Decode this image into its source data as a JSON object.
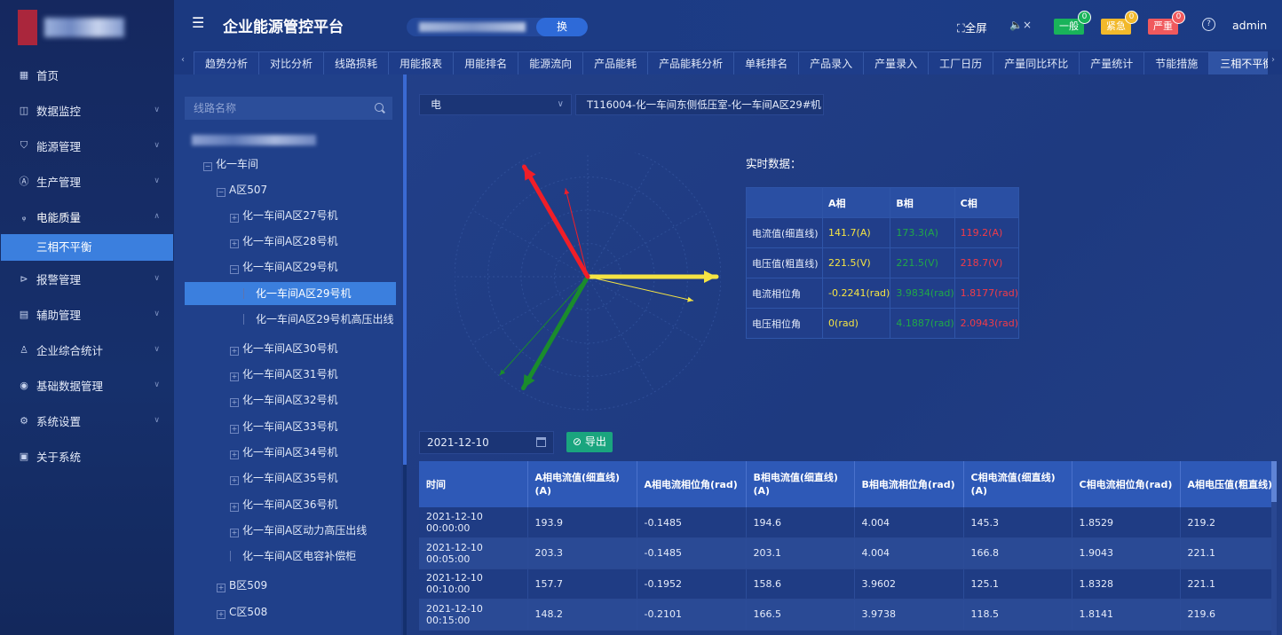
{
  "header": {
    "title": "企业能源管控平台",
    "switch_label": "换",
    "fullscreen_label": "全屏",
    "alarms": [
      {
        "label": "一般",
        "count": "0",
        "color": "#19b35a"
      },
      {
        "label": "紧急",
        "count": "0",
        "color": "#f2b92c"
      },
      {
        "label": "严重",
        "count": "0",
        "color": "#f0595d"
      }
    ],
    "user": "admin"
  },
  "sidebar": {
    "items": [
      {
        "label": "首页",
        "icon": "home-icon"
      },
      {
        "label": "数据监控",
        "icon": "monitor-icon"
      },
      {
        "label": "能源管理",
        "icon": "shield-icon"
      },
      {
        "label": "生产管理",
        "icon": "production-icon"
      },
      {
        "label": "电能质量",
        "icon": "power-quality-icon"
      },
      {
        "label": "报警管理",
        "icon": "alarm-icon"
      },
      {
        "label": "辅助管理",
        "icon": "assist-icon"
      },
      {
        "label": "企业综合统计",
        "icon": "statistics-icon"
      },
      {
        "label": "基础数据管理",
        "icon": "database-icon"
      },
      {
        "label": "系统设置",
        "icon": "settings-icon"
      },
      {
        "label": "关于系统",
        "icon": "about-icon"
      }
    ],
    "submenu_active": "三相不平衡"
  },
  "tabs": [
    "趋势分析",
    "对比分析",
    "线路损耗",
    "用能报表",
    "用能排名",
    "能源流向",
    "产品能耗",
    "产品能耗分析",
    "单耗排名",
    "产品录入",
    "产量录入",
    "工厂日历",
    "产量同比环比",
    "产量统计",
    "节能措施",
    "三相不平衡"
  ],
  "tree": {
    "search_placeholder": "线路名称",
    "nodes": [
      {
        "label": "化一车间",
        "level": 1,
        "toggle": "−"
      },
      {
        "label": "A区507",
        "level": 2,
        "toggle": "−"
      },
      {
        "label": "化一车间A区27号机",
        "level": 3,
        "toggle": "+"
      },
      {
        "label": "化一车间A区28号机",
        "level": 3,
        "toggle": "+"
      },
      {
        "label": "化一车间A区29号机",
        "level": 3,
        "toggle": "−"
      },
      {
        "label": "化一车间A区29号机",
        "level": 4,
        "toggle": "",
        "selected": true
      },
      {
        "label": "化一车间A区29号机高压出线",
        "level": 4,
        "toggle": ""
      },
      {
        "label": "化一车间A区30号机",
        "level": 3,
        "toggle": "+"
      },
      {
        "label": "化一车间A区31号机",
        "level": 3,
        "toggle": "+"
      },
      {
        "label": "化一车间A区32号机",
        "level": 3,
        "toggle": "+"
      },
      {
        "label": "化一车间A区33号机",
        "level": 3,
        "toggle": "+"
      },
      {
        "label": "化一车间A区34号机",
        "level": 3,
        "toggle": "+"
      },
      {
        "label": "化一车间A区35号机",
        "level": 3,
        "toggle": "+"
      },
      {
        "label": "化一车间A区36号机",
        "level": 3,
        "toggle": "+"
      },
      {
        "label": "化一车间A区动力高压出线",
        "level": 3,
        "toggle": "+"
      },
      {
        "label": "化一车间A区电容补偿柜",
        "level": 3,
        "toggle": ""
      },
      {
        "label": "B区509",
        "level": 2,
        "toggle": "+"
      },
      {
        "label": "C区508",
        "level": 2,
        "toggle": "+"
      }
    ]
  },
  "filters": {
    "energy_type": "电",
    "line": "T116004-化一车间东侧低压室-化一车间A区29#机"
  },
  "realtime": {
    "title": "实时数据：",
    "headers": [
      "",
      "A相",
      "B相",
      "C相"
    ],
    "rows": [
      {
        "label": "电流值(细直线)",
        "a": "141.7(A)",
        "b": "173.3(A)",
        "c": "119.2(A)"
      },
      {
        "label": "电压值(粗直线)",
        "a": "221.5(V)",
        "b": "221.5(V)",
        "c": "218.7(V)"
      },
      {
        "label": "电流相位角",
        "a": "-0.2241(rad)",
        "b": "3.9834(rad)",
        "c": "1.8177(rad)"
      },
      {
        "label": "电压相位角",
        "a": "0(rad)",
        "b": "4.1887(rad)",
        "c": "2.0943(rad)"
      }
    ]
  },
  "phasor": {
    "voltage_mag": [
      221.5,
      221.5,
      218.7
    ],
    "voltage_angle": [
      0,
      4.1887,
      2.0943
    ],
    "current_mag": [
      141.7,
      173.3,
      119.2
    ],
    "current_angle": [
      -0.2241,
      3.9834,
      1.8177
    ],
    "colors": {
      "a": "#f5e443",
      "b": "#1a8c2c",
      "c": "#f01e28"
    }
  },
  "history": {
    "date": "2021-12-10",
    "export_label": "导出",
    "headers": [
      "时间",
      "A相电流值(细直线)(A)",
      "A相电流相位角(rad)",
      "B相电流值(细直线)(A)",
      "B相电流相位角(rad)",
      "C相电流值(细直线)(A)",
      "C相电流相位角(rad)",
      "A相电压值(粗直线)(V)"
    ],
    "rows": [
      [
        "2021-12-10 00:00:00",
        "193.9",
        "-0.1485",
        "194.6",
        "4.004",
        "145.3",
        "1.8529",
        "219.2"
      ],
      [
        "2021-12-10 00:05:00",
        "203.3",
        "-0.1485",
        "203.1",
        "4.004",
        "166.8",
        "1.9043",
        "221.1"
      ],
      [
        "2021-12-10 00:10:00",
        "157.7",
        "-0.1952",
        "158.6",
        "3.9602",
        "125.1",
        "1.8328",
        "221.1"
      ],
      [
        "2021-12-10 00:15:00",
        "148.2",
        "-0.2101",
        "166.5",
        "3.9738",
        "118.5",
        "1.8141",
        "219.6"
      ]
    ]
  }
}
